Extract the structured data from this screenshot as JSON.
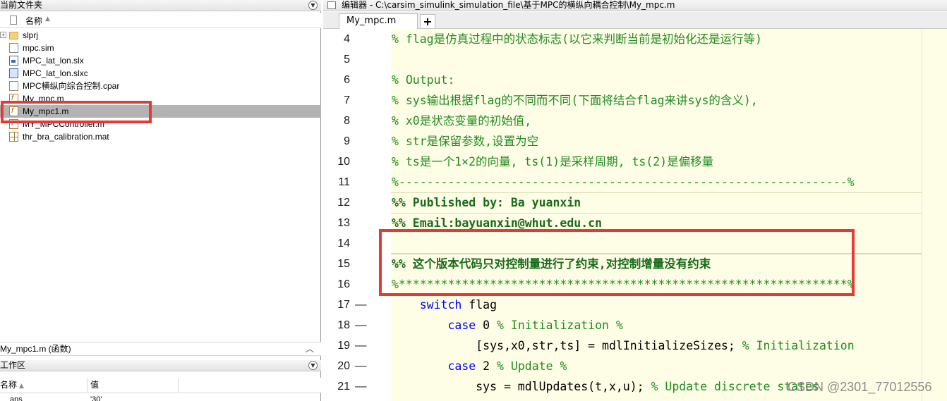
{
  "file_browser": {
    "title": "当前文件夹",
    "column_name": "名称",
    "files": [
      {
        "name": "slprj",
        "icon": "folder-icon",
        "expandable": true
      },
      {
        "name": "mpc.sim",
        "icon": "file-icon"
      },
      {
        "name": "MPC_lat_lon.slx",
        "icon": "simulink-model-icon"
      },
      {
        "name": "MPC_lat_lon.slxc",
        "icon": "simulink-cache-icon"
      },
      {
        "name": "MPC横纵向综合控制.cpar",
        "icon": "file-icon"
      },
      {
        "name": "My_mpc.m",
        "icon": "matlab-function-icon"
      },
      {
        "name": "My_mpc1.m",
        "icon": "matlab-function-icon",
        "selected": true
      },
      {
        "name": "MY_MPCController.m",
        "icon": "matlab-function-icon"
      },
      {
        "name": "thr_bra_calibration.mat",
        "icon": "mat-file-icon"
      }
    ],
    "details": "My_mpc1.m (函数)"
  },
  "workspace": {
    "title": "工作区",
    "col_name": "名称",
    "col_value": "值",
    "row": {
      "name": "ans",
      "value": "'30'"
    }
  },
  "editor": {
    "title": "编辑器 - C:\\carsim_simulink_simulation_file\\基于MPC的横纵向耦合控制\\My_mpc.m",
    "active_tab": "My_mpc.m",
    "add_tab": "+",
    "lines": [
      {
        "num": "4",
        "fold": false,
        "kind": "cmt",
        "text": "% flag是仿真过程中的状态标志(以它来判断当前是初始化还是运行等)"
      },
      {
        "num": "5",
        "fold": false,
        "kind": "plain",
        "text": ""
      },
      {
        "num": "6",
        "fold": false,
        "kind": "cmt",
        "text": "% Output:"
      },
      {
        "num": "7",
        "fold": false,
        "kind": "cmt",
        "text": "% sys输出根据flag的不同而不同(下面将结合flag来讲sys的含义),"
      },
      {
        "num": "8",
        "fold": false,
        "kind": "cmt",
        "text": "% x0是状态变量的初始值,"
      },
      {
        "num": "9",
        "fold": false,
        "kind": "cmt",
        "text": "% str是保留参数,设置为空"
      },
      {
        "num": "10",
        "fold": false,
        "kind": "cmt",
        "text": "% ts是一个1×2的向量, ts(1)是采样周期, ts(2)是偏移量"
      },
      {
        "num": "11",
        "fold": false,
        "kind": "cmt",
        "text": "%----------------------------------------------------------------%"
      },
      {
        "num": "12",
        "fold": false,
        "kind": "cell",
        "text": "%% Published by: Ba yuanxin"
      },
      {
        "num": "13",
        "fold": false,
        "kind": "cell",
        "text": "%% Email:bayuanxin@whut.edu.cn"
      },
      {
        "num": "14",
        "fold": false,
        "kind": "plain",
        "text": ""
      },
      {
        "num": "15",
        "fold": false,
        "kind": "cell",
        "text": "%% 这个版本代码只对控制量进行了约束,对控制增量没有约束"
      },
      {
        "num": "16",
        "fold": false,
        "kind": "cmt",
        "text": "%****************************************************************%"
      },
      {
        "num": "17",
        "fold": true,
        "kind": "mix",
        "parts": [
          {
            "c": "plain",
            "t": "    "
          },
          {
            "c": "kw",
            "t": "switch"
          },
          {
            "c": "plain",
            "t": " flag"
          }
        ]
      },
      {
        "num": "18",
        "fold": true,
        "kind": "mix",
        "parts": [
          {
            "c": "plain",
            "t": "        "
          },
          {
            "c": "kw",
            "t": "case"
          },
          {
            "c": "plain",
            "t": " 0 "
          },
          {
            "c": "cmt",
            "t": "% Initialization %"
          }
        ]
      },
      {
        "num": "19",
        "fold": true,
        "kind": "mix",
        "parts": [
          {
            "c": "plain",
            "t": "            [sys,x0,str,ts] = mdlInitializeSizes; "
          },
          {
            "c": "cmt",
            "t": "% Initialization"
          }
        ]
      },
      {
        "num": "20",
        "fold": true,
        "kind": "mix",
        "parts": [
          {
            "c": "plain",
            "t": "        "
          },
          {
            "c": "kw",
            "t": "case"
          },
          {
            "c": "plain",
            "t": " 2 "
          },
          {
            "c": "cmt",
            "t": "% Update %"
          }
        ]
      },
      {
        "num": "21",
        "fold": true,
        "kind": "mix",
        "parts": [
          {
            "c": "plain",
            "t": "            sys = mdlUpdates(t,x,u); "
          },
          {
            "c": "cmt",
            "t": "% Update discrete states"
          }
        ]
      }
    ]
  },
  "watermark": "CSDN @2301_77012556",
  "colors": {
    "annotation_red": "#e53935",
    "code_bg": "#fefee6",
    "comment": "#228b22",
    "keyword": "#0000ff",
    "selected_row": "#b3b3b3"
  }
}
